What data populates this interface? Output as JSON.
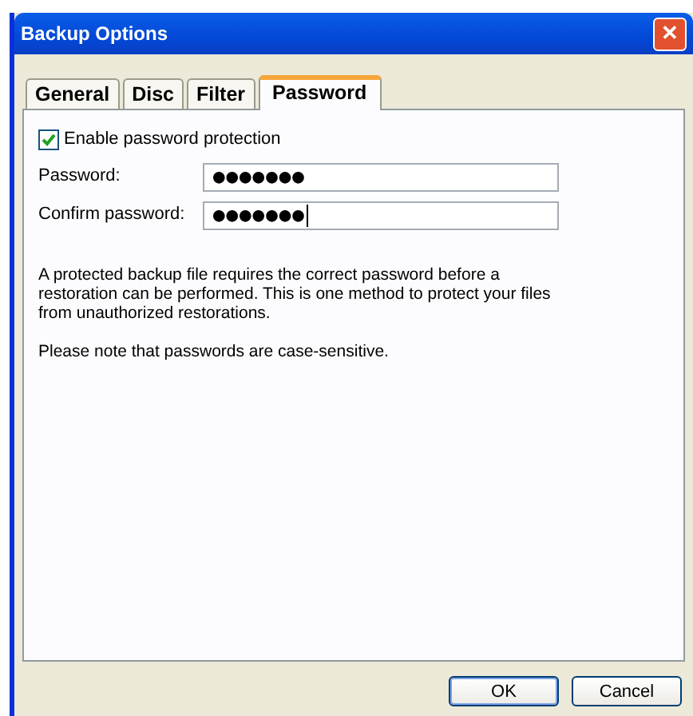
{
  "window": {
    "title": "Backup Options",
    "close": "✕"
  },
  "tabs": [
    {
      "label": "General",
      "selected": false
    },
    {
      "label": "Disc",
      "selected": false
    },
    {
      "label": "Filter",
      "selected": false
    },
    {
      "label": "Password",
      "selected": true
    }
  ],
  "enable_protection": {
    "label": "Enable password protection",
    "checked": true
  },
  "fields": [
    {
      "label": "Password:",
      "value": "●●●●●●●",
      "focused": false
    },
    {
      "label": "Confirm password:",
      "value": "●●●●●●●",
      "focused": true
    }
  ],
  "paragraphs": [
    "A protected backup file requires the correct password before a restoration can be performed. This is one method to protect your files from unauthorized restorations.",
    "Please note that passwords are case-sensitive."
  ],
  "buttons": [
    {
      "label": "OK",
      "default": true
    },
    {
      "label": "Cancel",
      "default": false
    }
  ]
}
